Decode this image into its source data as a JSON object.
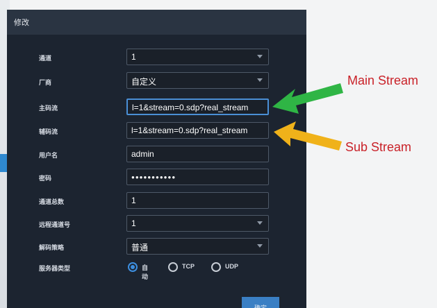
{
  "dialog": {
    "title": "修改",
    "ok_label": "确定"
  },
  "form": {
    "rows": [
      {
        "label": "通道",
        "value": "1"
      },
      {
        "label": "厂商",
        "value": "自定义"
      },
      {
        "label": "主码流",
        "value": "l=1&stream=0.sdp?real_stream"
      },
      {
        "label": "辅码流",
        "value": "l=1&stream=0.sdp?real_stream"
      },
      {
        "label": "用户名",
        "value": "admin"
      },
      {
        "label": "密码",
        "value": "●●●●●●●●●●●"
      },
      {
        "label": "通道总数",
        "value": "1"
      },
      {
        "label": "远程通道号",
        "value": "1"
      },
      {
        "label": "解码策略",
        "value": "普通"
      },
      {
        "label": "服务器类型",
        "options": [
          "自动",
          "TCP",
          "UDP"
        ],
        "selected": "自动"
      }
    ]
  },
  "annotations": {
    "main_stream": "Main Stream",
    "sub_stream": "Sub Stream",
    "main_arrow_color": "#2fb545",
    "sub_arrow_color": "#f0b21a"
  },
  "colors": {
    "dialog_bg": "#1c2430",
    "accent": "#3d8fe0",
    "annotation_text": "#c92128"
  }
}
